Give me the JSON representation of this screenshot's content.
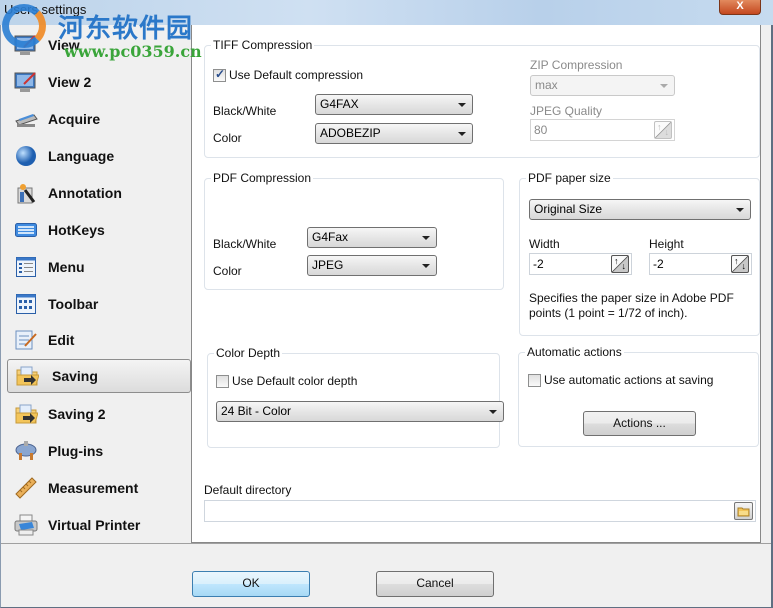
{
  "window": {
    "title": "Users settings",
    "close_label": "X",
    "watermark_cn": "河东软件园",
    "watermark_url": "www.pc0359.cn"
  },
  "sidebar": {
    "selected": "Saving",
    "items": [
      {
        "label": "View",
        "icon": "monitor-pen-icon"
      },
      {
        "label": "View 2",
        "icon": "monitor-pen-icon"
      },
      {
        "label": "Acquire",
        "icon": "scanner-icon"
      },
      {
        "label": "Language",
        "icon": "globe-icon"
      },
      {
        "label": "Annotation",
        "icon": "annotation-wand-icon"
      },
      {
        "label": "HotKeys",
        "icon": "keyboard-icon"
      },
      {
        "label": "Menu",
        "icon": "menu-list-icon"
      },
      {
        "label": "Toolbar",
        "icon": "toolbar-grid-icon"
      },
      {
        "label": "Edit",
        "icon": "edit-document-icon"
      },
      {
        "label": "Saving",
        "icon": "folder-save-icon"
      },
      {
        "label": "Saving 2",
        "icon": "folder-save-icon"
      },
      {
        "label": "Plug-ins",
        "icon": "plug-icon"
      },
      {
        "label": "Measurement",
        "icon": "ruler-icon"
      },
      {
        "label": "Virtual Printer",
        "icon": "printer-icon"
      }
    ]
  },
  "tiff": {
    "title": "TIFF Compression",
    "use_default_label": "Use Default compression",
    "use_default_checked": true,
    "bw_label": "Black/White",
    "bw_value": "G4FAX",
    "color_label": "Color",
    "color_value": "ADOBEZIP",
    "zip_label": "ZIP Compression",
    "zip_value": "max",
    "jpeg_label": "JPEG Quality",
    "jpeg_value": "80"
  },
  "pdf_compression": {
    "title": "PDF Compression",
    "bw_label": "Black/White",
    "bw_value": "G4Fax",
    "color_label": "Color",
    "color_value": "JPEG"
  },
  "pdf_paper": {
    "title": "PDF paper size",
    "size_value": "Original Size",
    "width_label": "Width",
    "width_value": "-2",
    "height_label": "Height",
    "height_value": "-2",
    "description": "Specifies the paper size in Adobe PDF points (1 point = 1/72 of inch)."
  },
  "color_depth": {
    "title": "Color Depth",
    "use_default_label": "Use Default color depth",
    "use_default_checked": false,
    "value": "24 Bit - Color"
  },
  "auto_actions": {
    "title": "Automatic actions",
    "use_label": "Use automatic actions at saving",
    "use_checked": false,
    "actions_button": "Actions ..."
  },
  "default_directory": {
    "label": "Default directory",
    "value": ""
  },
  "footer": {
    "ok_label": "OK",
    "cancel_label": "Cancel"
  }
}
